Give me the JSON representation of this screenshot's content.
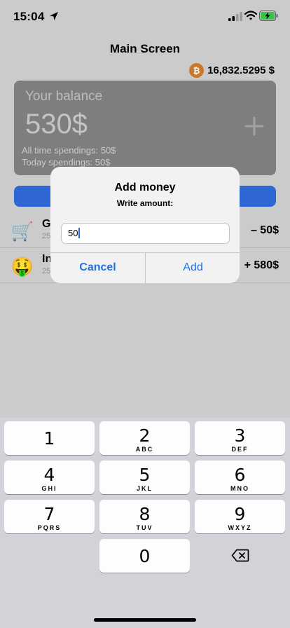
{
  "status_bar": {
    "time": "15:04"
  },
  "header": {
    "title": "Main Screen",
    "crypto_value": "16,832.5295 $",
    "crypto_symbol": "₿"
  },
  "balance": {
    "label": "Your balance",
    "amount": "530$",
    "all_time": "All time spendings: 50$",
    "today": "Today spendings: 50$"
  },
  "transactions": [
    {
      "emoji": "🛒",
      "title": "G",
      "subtitle": "25",
      "amount": "– 50$"
    },
    {
      "emoji": "🤑",
      "title": "In",
      "subtitle": "25",
      "amount": "+ 580$"
    }
  ],
  "alert": {
    "title": "Add money",
    "message": "Write amount:",
    "input_value": "50",
    "cancel_label": "Cancel",
    "add_label": "Add"
  },
  "keypad": {
    "keys": [
      {
        "num": "1",
        "letters": ""
      },
      {
        "num": "2",
        "letters": "ABC"
      },
      {
        "num": "3",
        "letters": "DEF"
      },
      {
        "num": "4",
        "letters": "GHI"
      },
      {
        "num": "5",
        "letters": "JKL"
      },
      {
        "num": "6",
        "letters": "MNO"
      },
      {
        "num": "7",
        "letters": "PQRS"
      },
      {
        "num": "8",
        "letters": "TUV"
      },
      {
        "num": "9",
        "letters": "WXYZ"
      },
      {
        "num": "0",
        "letters": ""
      }
    ]
  },
  "colors": {
    "accent": "#1f74e9",
    "action_button": "#2e66d4",
    "bitcoin": "#c9772a",
    "battery": "#36c549"
  },
  "icons": [
    "location-arrow-icon",
    "signal-icon",
    "wifi-icon",
    "battery-icon",
    "bitcoin-icon",
    "plus-icon",
    "delete-icon"
  ]
}
